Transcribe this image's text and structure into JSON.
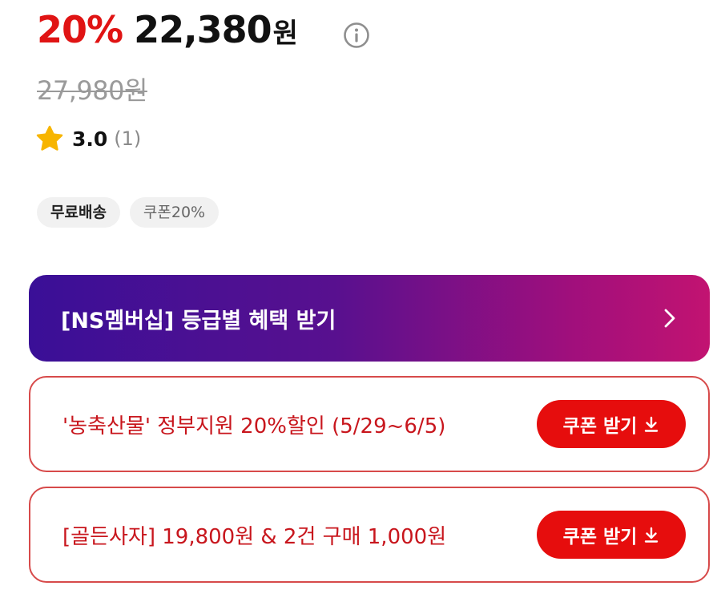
{
  "price": {
    "discount": "20%",
    "amount": "22,380",
    "currency": "원",
    "original": "27,980원"
  },
  "rating": {
    "score": "3.0",
    "count": "(1)"
  },
  "chips": [
    "무료배송",
    "쿠폰20%"
  ],
  "banner": {
    "label": "[NS멤버십] 등급별 혜택 받기"
  },
  "coupons": [
    {
      "text": "'농축산물' 정부지원 20%할인 (5/29~6/5)",
      "button": "쿠폰 받기"
    },
    {
      "text": "[골든사자] 19,800원 & 2건 구매 1,000원",
      "button": "쿠폰 받기"
    }
  ],
  "colors": {
    "accent": "#e01414",
    "coupon_border": "#d74a4a",
    "banner_start": "#3a0f97",
    "banner_end": "#c21371",
    "star": "#f7b500"
  }
}
